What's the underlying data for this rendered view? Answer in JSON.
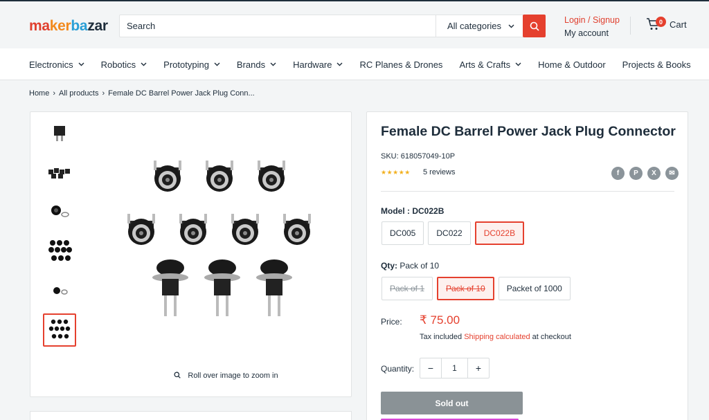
{
  "header": {
    "logo": {
      "part1": "ma",
      "part2": "ker",
      "part3": "ba",
      "part4": "zar"
    },
    "search_placeholder": "Search",
    "category_select": "All categories",
    "login_label": "Login / Signup",
    "account_label": "My account",
    "cart_count": "0",
    "cart_label": "Cart"
  },
  "nav": {
    "items": [
      {
        "label": "Electronics",
        "dropdown": true
      },
      {
        "label": "Robotics",
        "dropdown": true
      },
      {
        "label": "Prototyping",
        "dropdown": true
      },
      {
        "label": "Brands",
        "dropdown": true
      },
      {
        "label": "Hardware",
        "dropdown": true
      },
      {
        "label": "RC Planes & Drones",
        "dropdown": false
      },
      {
        "label": "Arts & Crafts",
        "dropdown": true
      },
      {
        "label": "Home & Outdoor",
        "dropdown": false
      },
      {
        "label": "Projects & Books",
        "dropdown": false
      }
    ]
  },
  "breadcrumb": [
    "Home",
    "All products",
    "Female DC Barrel Power Jack Plug Conn..."
  ],
  "breadcrumb_sep": "›",
  "gallery": {
    "zoom_hint": "Roll over image to zoom in"
  },
  "product": {
    "title": "Female DC Barrel Power Jack Plug Connector",
    "sku": "SKU: 618057049-10P",
    "stars": "★★★★★",
    "reviews": "5 reviews",
    "share": [
      "f",
      "P",
      "X",
      "✉"
    ],
    "model_label": "Model :",
    "model_value": "DC022B",
    "models": [
      "DC005",
      "DC022",
      "DC022B"
    ],
    "qty_label": "Qty:",
    "qty_value": "Pack of 10",
    "qty_options": [
      "Pack of 1",
      "Pack of 10",
      "Packet of 1000"
    ],
    "price_label": "Price:",
    "price": "₹ 75.00",
    "tax_prefix": "Tax included ",
    "tax_link": "Shipping calculated",
    "tax_suffix": " at checkout",
    "quantity_label": "Quantity:",
    "quantity_minus": "−",
    "quantity_value": "1",
    "quantity_plus": "+",
    "soldout_label": "Sold out"
  },
  "colors": {
    "accent": "#e5402e",
    "text": "#1e2d3b",
    "star": "#f2b01e"
  }
}
